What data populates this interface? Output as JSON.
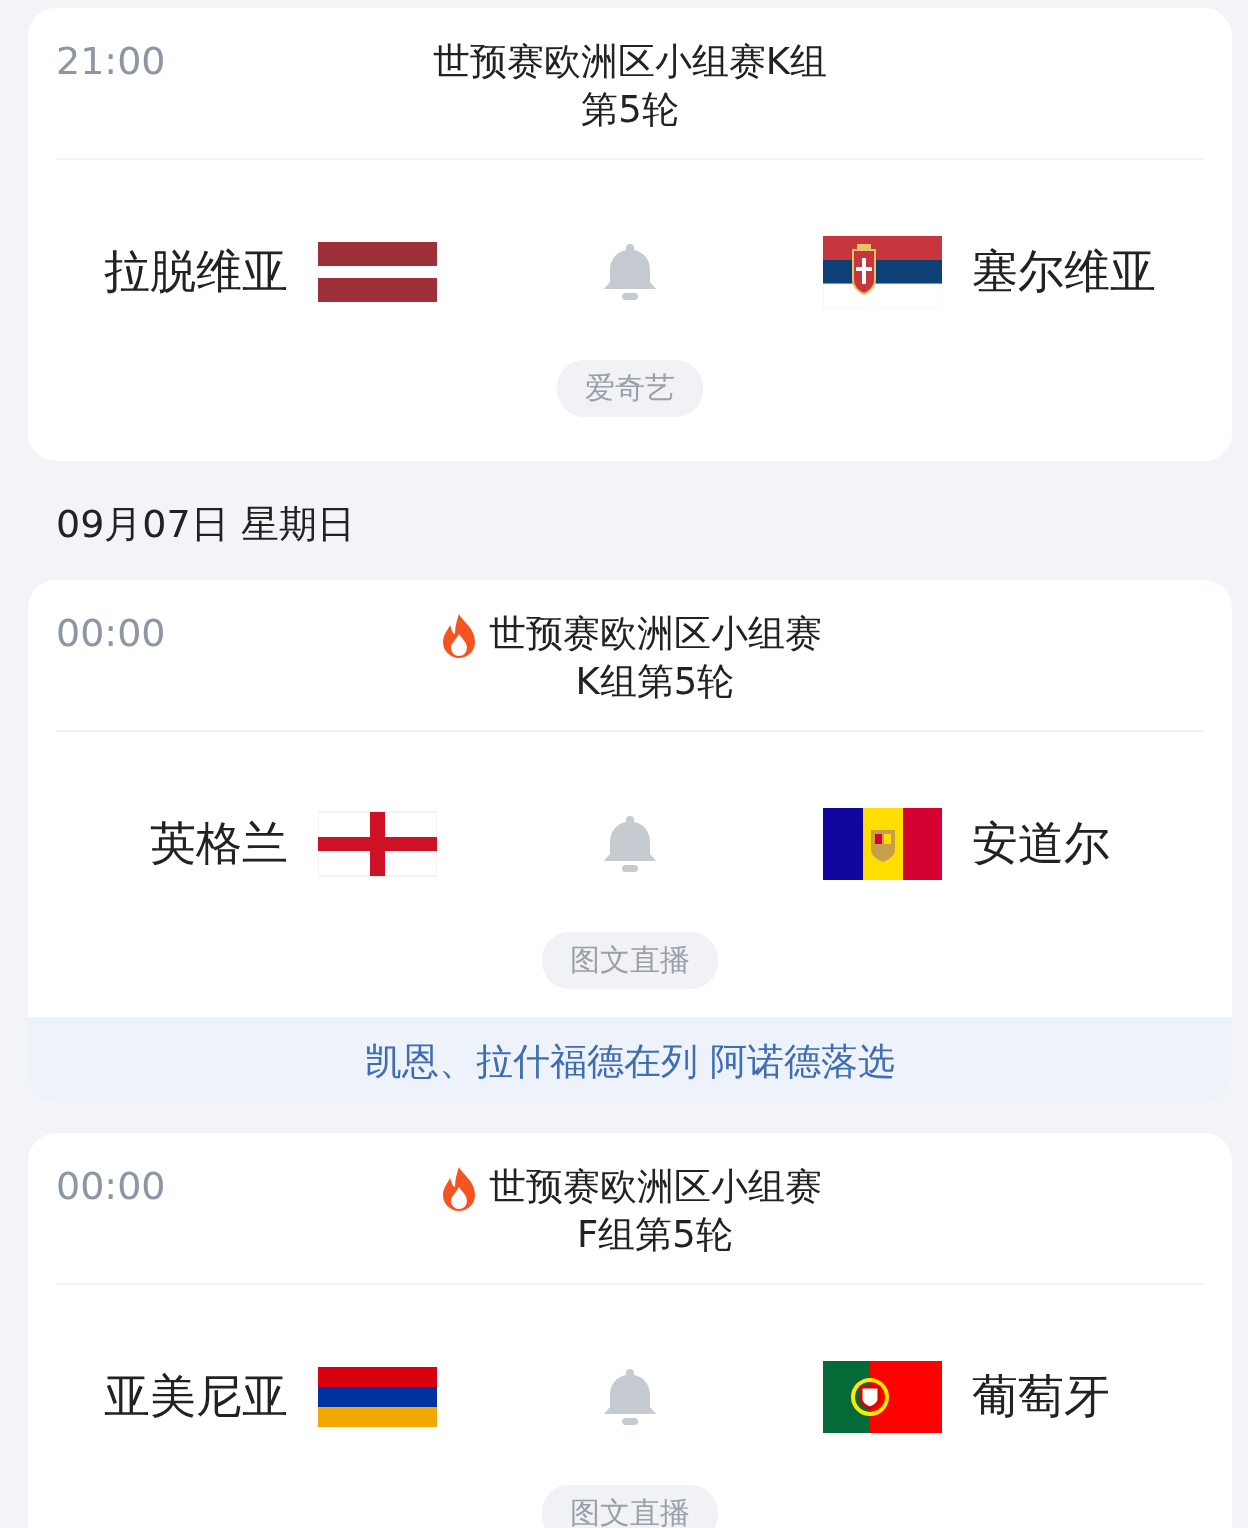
{
  "sections": [
    {
      "matches": [
        {
          "time": "21:00",
          "hot": false,
          "title": [
            "世预赛欧洲区小组赛K组",
            "第5轮"
          ],
          "home": {
            "name": "拉脱维亚",
            "kind": "latvia"
          },
          "away": {
            "name": "塞尔维亚",
            "kind": "serbia"
          },
          "broadcast": "爱奇艺"
        }
      ]
    },
    {
      "date": "09月07日 星期日",
      "matches": [
        {
          "time": "00:00",
          "hot": true,
          "title": [
            "世预赛欧洲区小组赛",
            "K组第5轮"
          ],
          "home": {
            "name": "英格兰",
            "kind": "england"
          },
          "away": {
            "name": "安道尔",
            "kind": "andorra"
          },
          "broadcast": "图文直播",
          "news": "凯恩、拉什福德在列 阿诺德落选"
        },
        {
          "time": "00:00",
          "hot": true,
          "title": [
            "世预赛欧洲区小组赛",
            "F组第5轮"
          ],
          "home": {
            "name": "亚美尼亚",
            "kind": "armenia"
          },
          "away": {
            "name": "葡萄牙",
            "kind": "portugal"
          },
          "broadcast": "图文直播"
        }
      ]
    }
  ]
}
